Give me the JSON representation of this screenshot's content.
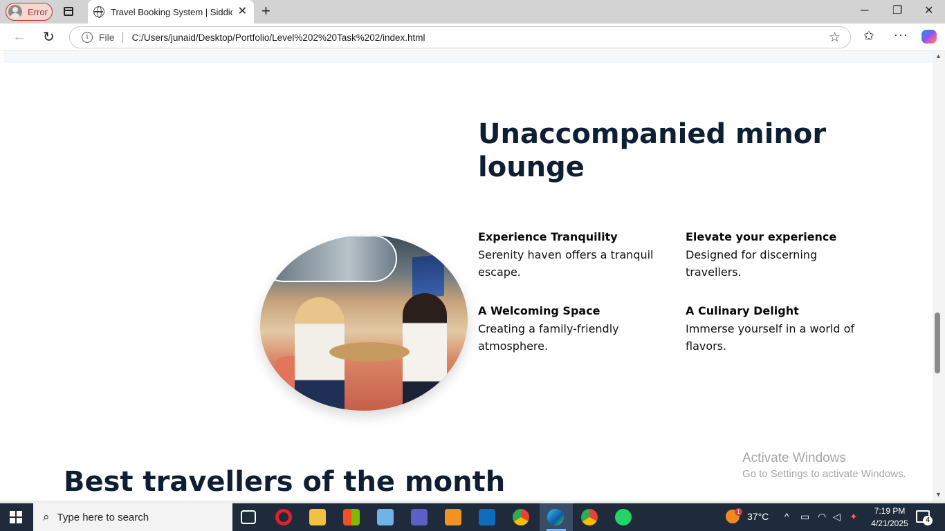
{
  "browser": {
    "profile_label": "Error",
    "tab_title": "Travel Booking System | Siddiqui",
    "address_scheme": "File",
    "address_url": "C:/Users/junaid/Desktop/Portfolio/Level%202%20Task%202/index.html"
  },
  "page": {
    "lounge_heading": "Unaccompanied minor lounge",
    "features": [
      {
        "title": "Experience Tranquility",
        "description": "Serenity haven offers a tranquil escape."
      },
      {
        "title": "Elevate your experience",
        "description": "Designed for discerning travellers."
      },
      {
        "title": "A Welcoming Space",
        "description": "Creating a family-friendly atmosphere."
      },
      {
        "title": "A Culinary Delight",
        "description": "Immerse yourself in a world of flavors."
      }
    ],
    "best_heading": "Best travellers of the month"
  },
  "watermark": {
    "title": "Activate Windows",
    "subtitle": "Go to Settings to activate Windows."
  },
  "taskbar": {
    "search_placeholder": "Type here to search",
    "weather_badge": "1",
    "temperature": "37°C",
    "time": "7:19 PM",
    "date": "4/21/2025",
    "notification_count": "4"
  },
  "colors": {
    "heading": "#0e1e33",
    "taskbar": "#1f2b3a",
    "profile_error": "#c4302b"
  }
}
